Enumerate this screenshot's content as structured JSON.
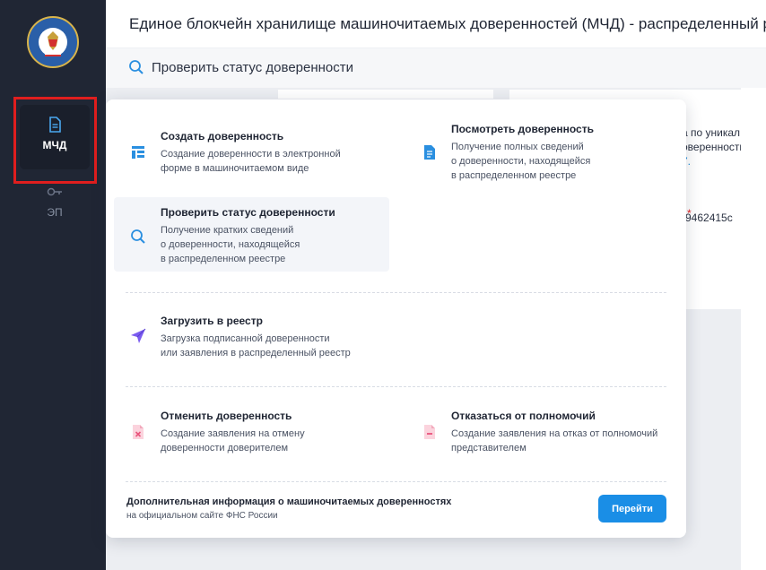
{
  "sidebar": {
    "items": [
      {
        "label": "МЧД",
        "icon": "document-icon",
        "active": true
      },
      {
        "label": "ЭП",
        "icon": "key-icon",
        "active": false
      }
    ]
  },
  "header": {
    "title": "Единое блокчейн хранилище машиночитаемых доверенностей (МЧД) - распределенный р"
  },
  "subheader": {
    "label": "Проверить статус доверенности",
    "icon": "search-icon"
  },
  "background": {
    "right_text_lines": [
      "а по уникал",
      "оверенности",
      "7."
    ],
    "required_mark": "*",
    "value_text": "-9462415c"
  },
  "menu": {
    "items": [
      {
        "title": "Создать доверенность",
        "desc": [
          "Создание доверенности в электронной",
          "форме в машиночитаемом виде"
        ],
        "icon": "form-icon"
      },
      {
        "title": "Посмотреть доверенность",
        "desc": [
          "Получение полных сведений",
          "о доверенности, находящейся",
          "в распределенном реестре"
        ],
        "icon": "file-icon"
      },
      {
        "title": "Проверить статус доверенности",
        "desc": [
          "Получение кратких сведений",
          "о доверенности, находящейся",
          "в распределенном реестре"
        ],
        "icon": "search-icon"
      },
      {
        "title": "Загрузить в реестр",
        "desc": [
          "Загрузка подписанной доверенности",
          "или заявления в распределенный реестр"
        ],
        "icon": "send-icon"
      },
      {
        "title": "Отменить доверенность",
        "desc": [
          "Создание заявления на отмену",
          "доверенности доверителем"
        ],
        "icon": "file-cancel-icon"
      },
      {
        "title": "Отказаться от полномочий",
        "desc": [
          "Создание заявления на отказ от полномочий",
          "представителем"
        ],
        "icon": "file-minus-icon"
      }
    ],
    "footer": {
      "title": "Дополнительная информация о машиночитаемых доверенностях",
      "subtitle": "на официальном сайте ФНС России",
      "button_label": "Перейти"
    }
  },
  "colors": {
    "sidebar_bg": "#202634",
    "accent": "#1a8ee6",
    "highlight": "#e01e1e",
    "icon_blue": "#2a8fe0",
    "icon_purple": "#7b5cf0",
    "icon_pink": "#e8547c"
  }
}
